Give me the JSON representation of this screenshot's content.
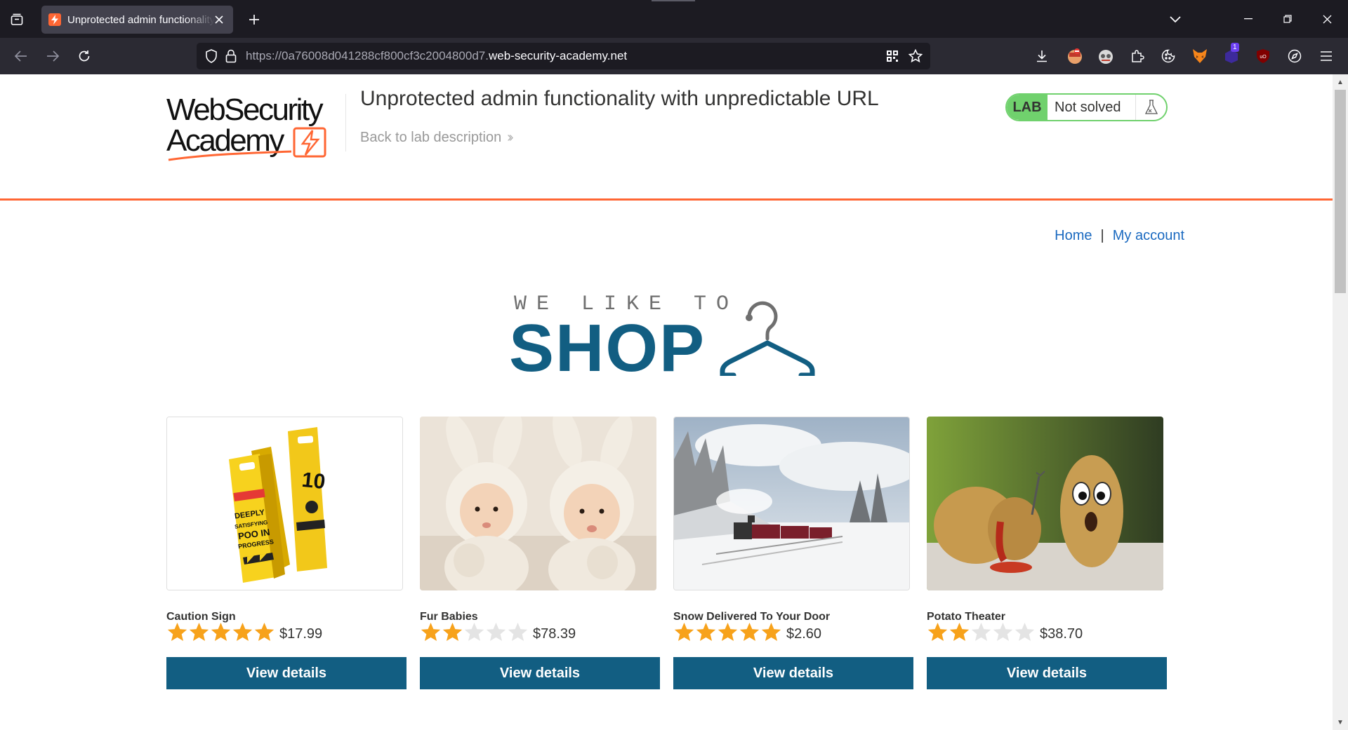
{
  "browser": {
    "tab": {
      "title": "Unprotected admin functionality with unpredictable URL"
    },
    "url": {
      "prefix": "https://0a76008d041288cf800cf3c2004800d7.",
      "domain": "web-security-academy.net"
    },
    "extension_badge": "1"
  },
  "lab_header": {
    "logo_line1": "WebSecurity",
    "logo_line2": "Academy",
    "title": "Unprotected admin functionality with unpredictable URL",
    "back_link": "Back to lab description",
    "badge": "LAB",
    "status": "Not solved"
  },
  "nav": {
    "home": "Home",
    "separator": "|",
    "account": "My account"
  },
  "hero": {
    "small": "WE LIKE TO",
    "big": "SHOP"
  },
  "products": [
    {
      "name": "Caution Sign",
      "rating": 5,
      "price": "$17.99",
      "button": "View details"
    },
    {
      "name": "Fur Babies",
      "rating": 2,
      "price": "$78.39",
      "button": "View details"
    },
    {
      "name": "Snow Delivered To Your Door",
      "rating": 5,
      "price": "$2.60",
      "button": "View details"
    },
    {
      "name": "Potato Theater",
      "rating": 2,
      "price": "$38.70",
      "button": "View details"
    }
  ],
  "colors": {
    "accent": "#ff6633",
    "brand_blue": "#125e82",
    "link": "#1b6ac0",
    "lab_green": "#70d16d",
    "star_on": "#f7a21b",
    "star_off": "#e4e4e4"
  }
}
